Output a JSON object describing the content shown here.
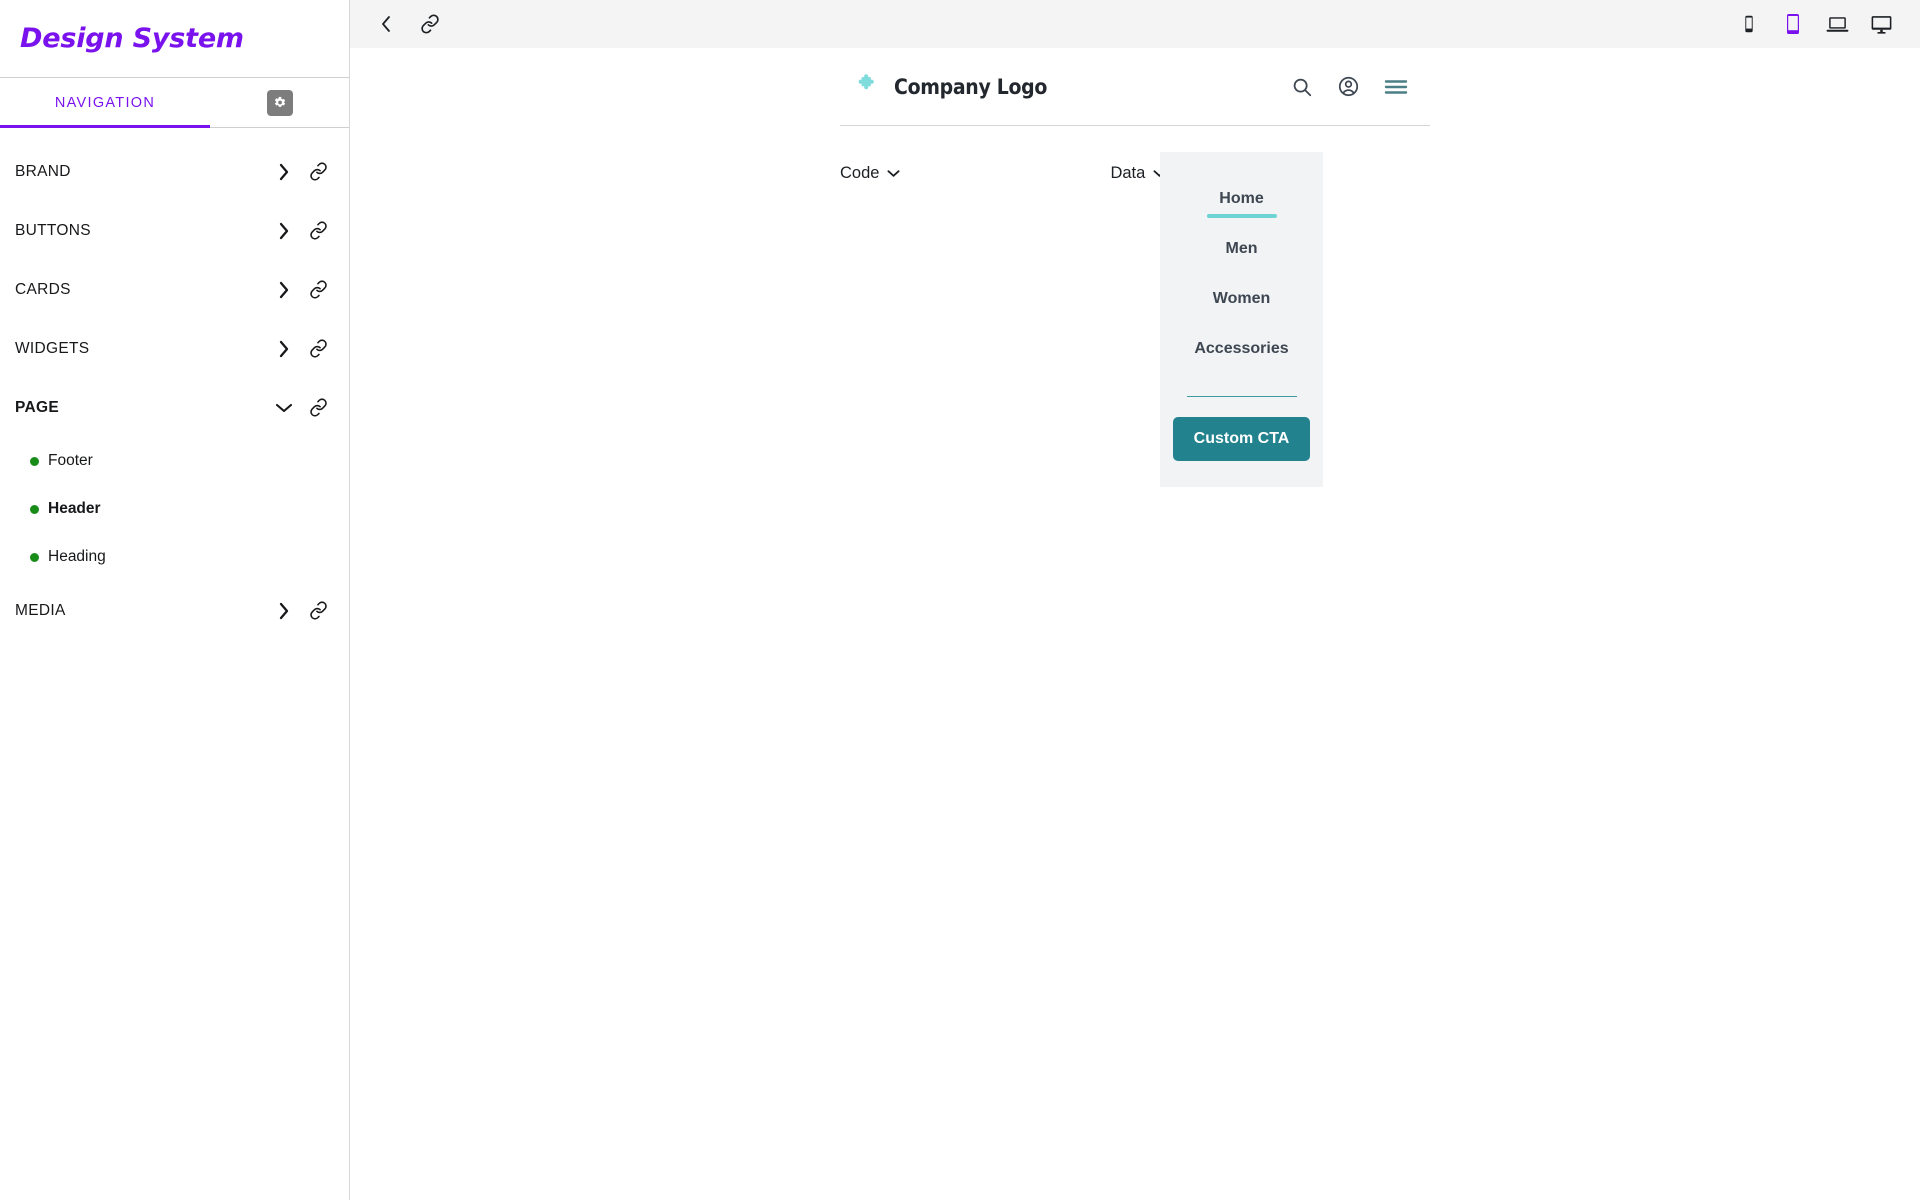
{
  "app": {
    "title": "Design System"
  },
  "sidebar": {
    "tabs": [
      {
        "label": "NAVIGATION",
        "icon": "navigation-tab",
        "active": true
      },
      {
        "label": "",
        "icon": "gear-icon",
        "active": false
      }
    ],
    "accent_color": "#7a12ee",
    "groups": [
      {
        "label": "BRAND",
        "state": "collapsed",
        "chevron": "chevron-right-icon",
        "link": "link-icon"
      },
      {
        "label": "BUTTONS",
        "state": "collapsed",
        "chevron": "chevron-right-icon",
        "link": "link-icon"
      },
      {
        "label": "CARDS",
        "state": "collapsed",
        "chevron": "chevron-right-icon",
        "link": "link-icon"
      },
      {
        "label": "WIDGETS",
        "state": "collapsed",
        "chevron": "chevron-right-icon",
        "link": "link-icon"
      },
      {
        "label": "PAGE",
        "state": "expanded",
        "chevron": "chevron-down-icon",
        "link": "link-icon"
      },
      {
        "label": "MEDIA",
        "state": "collapsed",
        "chevron": "chevron-right-icon",
        "link": "link-icon"
      }
    ],
    "page_items": [
      {
        "label": "Footer",
        "dot_color": "#188c18",
        "active": false
      },
      {
        "label": "Header",
        "dot_color": "#188c18",
        "active": true
      },
      {
        "label": "Heading",
        "dot_color": "#188c18",
        "active": false
      }
    ]
  },
  "toolbar": {
    "back": "chevron-left-icon",
    "link": "link-icon",
    "devices": [
      {
        "name": "mobile-icon",
        "label": "Mobile",
        "selected": false
      },
      {
        "name": "tablet-icon",
        "label": "Tablet",
        "selected": true
      },
      {
        "name": "laptop-icon",
        "label": "Laptop",
        "selected": false
      },
      {
        "name": "desktop-icon",
        "label": "Desktop",
        "selected": false
      }
    ],
    "selected_color": "#7a12ee"
  },
  "preview": {
    "site_header": {
      "logo_icon": "puzzle-piece-icon",
      "logo_color": "#7fdcdc",
      "company_name": "Company Logo",
      "icons": [
        {
          "name": "search-icon",
          "label": "Search"
        },
        {
          "name": "account-icon",
          "label": "Account"
        },
        {
          "name": "menu-icon",
          "label": "Menu"
        }
      ]
    },
    "toggles": [
      {
        "label": "Code",
        "icon": "chevron-down-icon"
      },
      {
        "label": "Data",
        "icon": "chevron-down-icon"
      }
    ],
    "menu": {
      "links": [
        {
          "label": "Home",
          "active": true
        },
        {
          "label": "Men",
          "active": false
        },
        {
          "label": "Women",
          "active": false
        },
        {
          "label": "Accessories",
          "active": false
        }
      ],
      "cta_label": "Custom CTA",
      "cta_color": "#22838f",
      "accent_color": "#6ed3d3"
    }
  }
}
